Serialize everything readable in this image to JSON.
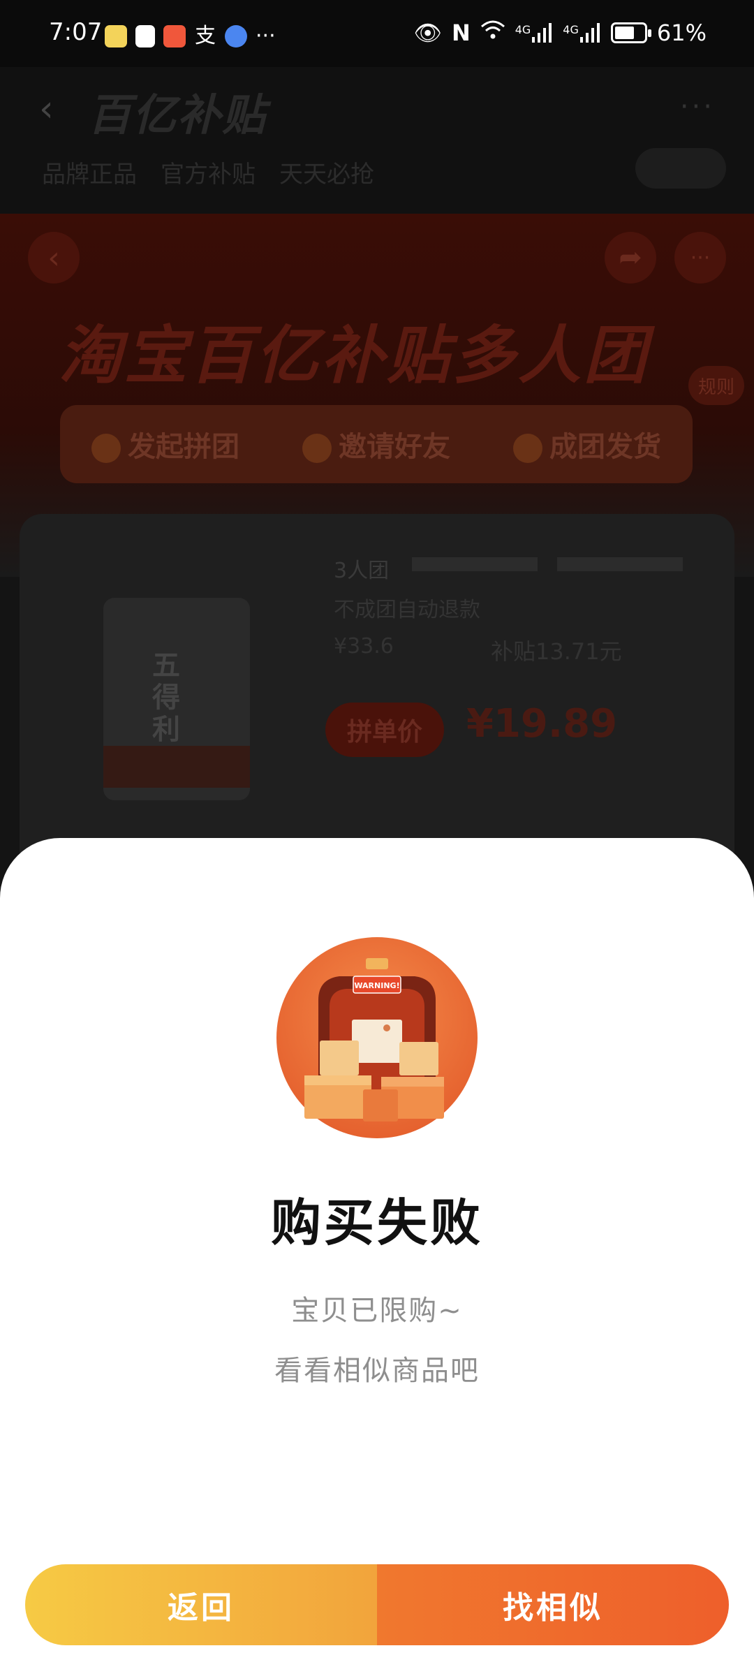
{
  "status_bar": {
    "time": "7:07",
    "more_apps": "···",
    "battery": "61%",
    "network_1": "4G",
    "network_2": "4G"
  },
  "background": {
    "header_title": "百亿补贴",
    "tags": [
      "品牌正品",
      "官方补贴",
      "天天必抢"
    ],
    "banner_title": "淘宝百亿补贴多人团",
    "rules": "规则",
    "steps": [
      "发起拼团",
      "邀请好友",
      "成团发货"
    ],
    "product": {
      "group_size": "3人团",
      "refund_note": "不成团自动退款",
      "original_price": "¥33.6",
      "subsidy": "补贴13.71元",
      "price_label": "拼单价",
      "price": "¥19.89",
      "package_text": "五得利"
    }
  },
  "modal": {
    "illustration_text": "WARNING!",
    "title": "购买失败",
    "subtitle_line1": "宝贝已限购~",
    "subtitle_line2": "看看相似商品吧",
    "back_button": "返回",
    "similar_button": "找相似"
  },
  "colors": {
    "button_left_start": "#f6ca44",
    "button_right_end": "#ee5f2b",
    "title": "#111111",
    "subtitle": "#8e8e8e"
  }
}
